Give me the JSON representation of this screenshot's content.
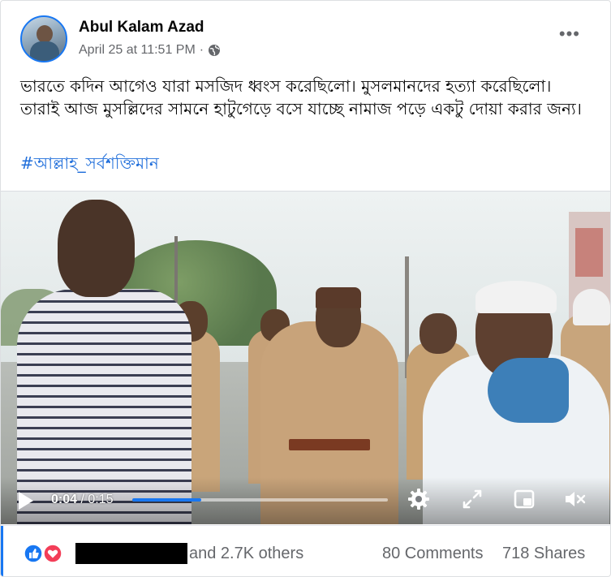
{
  "post": {
    "author": "Abul Kalam Azad",
    "timestamp": "April 25 at 11:51 PM",
    "separator": "·",
    "privacy_icon": "globe-icon",
    "menu_icon": "more-options-icon",
    "text": "ভারতে কদিন আগেও যারা মসজিদ ধ্বংস করেছিলো। মুসলমানদের হত্যা করেছিলো। তারাই আজ মুসল্লিদের সামনে হাটুগেড়ে বসে যাচ্ছে নামাজ পড়ে একটু দোয়া করার জন্য।",
    "hashtag": "#আল্লাহ_সর্বশক্তিমান"
  },
  "video": {
    "current_time": "0:04",
    "duration": "/ 0:15",
    "progress_fraction": 0.27,
    "icons": [
      "play-icon",
      "settings-gear-icon",
      "expand-icon",
      "picture-in-picture-icon",
      "muted-volume-icon"
    ]
  },
  "engagement": {
    "reaction_icons": [
      "like-icon",
      "love-icon"
    ],
    "reactors_text": "and 2.7K others",
    "comments": "80 Comments",
    "shares": "718 Shares"
  },
  "colors": {
    "accent": "#1877f2",
    "hashtag": "#216fdb",
    "secondary_text": "#65676b"
  }
}
